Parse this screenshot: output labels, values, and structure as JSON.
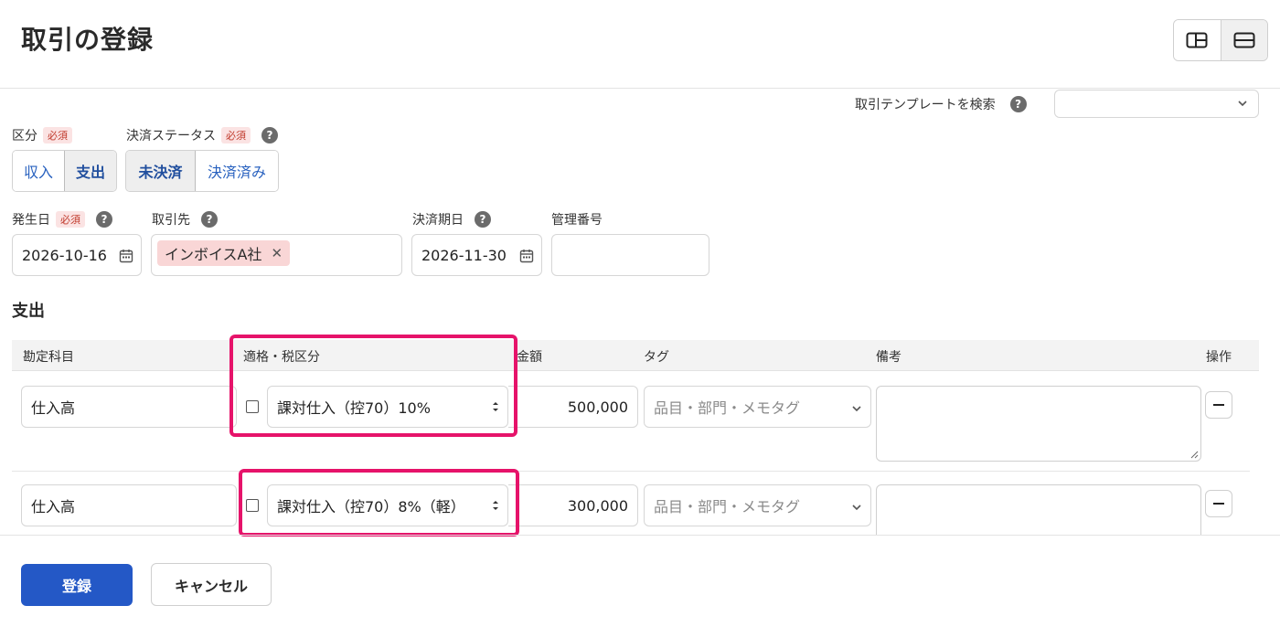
{
  "header": {
    "title": "取引の登録"
  },
  "template_search": {
    "label": "取引テンプレートを検索",
    "help": "?",
    "value": ""
  },
  "kubun": {
    "label": "区分",
    "required": "必須",
    "options": [
      "収入",
      "支出"
    ],
    "selected": "支出"
  },
  "status": {
    "label": "決済ステータス",
    "required": "必須",
    "help": "?",
    "options": [
      "未決済",
      "決済済み"
    ],
    "selected": "未決済"
  },
  "hasseibi": {
    "label": "発生日",
    "required": "必須",
    "help": "?",
    "value": "2026-10-16"
  },
  "torihikisaki": {
    "label": "取引先",
    "help": "?",
    "chip": "インボイスA社",
    "chip_remove": "✕"
  },
  "kessai_kijitsu": {
    "label": "決済期日",
    "help": "?",
    "value": "2026-11-30"
  },
  "kanri_bangou": {
    "label": "管理番号",
    "value": ""
  },
  "section": {
    "title": "支出"
  },
  "table": {
    "headers": {
      "account": "勘定科目",
      "tax": "適格・税区分",
      "amount": "金額",
      "tag": "タグ",
      "memo": "備考",
      "action": "操作"
    },
    "rows": [
      {
        "account": "仕入高",
        "tax": "課対仕入（控70）10%",
        "amount": "500,000",
        "tag_placeholder": "品目・部門・メモタグ",
        "memo": ""
      },
      {
        "account": "仕入高",
        "tax": "課対仕入（控70）8%（軽）",
        "amount": "300,000",
        "tag_placeholder": "品目・部門・メモタグ",
        "memo": ""
      }
    ]
  },
  "footer": {
    "submit": "登録",
    "cancel": "キャンセル"
  },
  "colors": {
    "primary": "#2458c6",
    "highlight": "#e6136a",
    "required_bg": "#fbe3e3",
    "chip_bg": "#f9d6d6"
  },
  "icons": [
    "layout-split-icon",
    "layout-stacked-icon",
    "help-icon",
    "chevron-down-icon",
    "calendar-icon",
    "close-icon",
    "updown-icon",
    "minus-icon",
    "resize-grip-icon"
  ]
}
